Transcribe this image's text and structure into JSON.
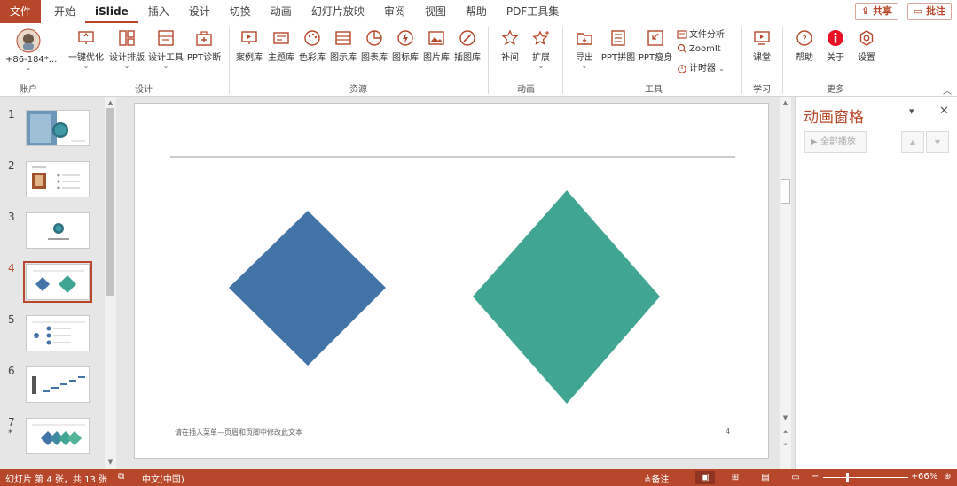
{
  "tabs": [
    "文件",
    "开始",
    "iSlide",
    "插入",
    "设计",
    "切换",
    "动画",
    "幻灯片放映",
    "审阅",
    "视图",
    "帮助",
    "PDF工具集"
  ],
  "share_label": "共享",
  "comment_label": "批注",
  "ribbon": {
    "account": {
      "user": "+86-184*...",
      "group": "账户"
    },
    "design": {
      "buttons": [
        "一键优化",
        "设计排版",
        "设计工具",
        "PPT诊断"
      ],
      "group": "设计"
    },
    "resources": {
      "buttons": [
        "案例库",
        "主题库",
        "色彩库",
        "图示库",
        "图表库",
        "图标库",
        "图片库",
        "插图库"
      ],
      "group": "资源"
    },
    "animation": {
      "buttons": [
        "补间",
        "扩展"
      ],
      "group": "动画"
    },
    "tools": {
      "buttons": [
        "导出",
        "PPT拼图",
        "PPT瘦身"
      ],
      "small": [
        "文件分析",
        "ZoomIt",
        "计时器"
      ],
      "group": "工具"
    },
    "learning": {
      "buttons": [
        "课堂"
      ],
      "group": "学习"
    },
    "more": {
      "buttons": [
        "帮助",
        "关于",
        "设置"
      ],
      "group": "更多"
    }
  },
  "thumbnails": [
    "1",
    "2",
    "3",
    "4",
    "5",
    "6",
    "7"
  ],
  "selected_slide": "4",
  "slide7_mark": "*",
  "slide": {
    "footer_text": "请在插入菜单—页眉和页脚中修改此文本",
    "page_number": "4",
    "colors": {
      "left_diamond": "#4374a7",
      "right_diamond": "#40a592"
    }
  },
  "anim_pane": {
    "title": "动画窗格",
    "play_all": "全部播放"
  },
  "status": {
    "slide_info": "幻灯片 第 4 张，共 13 张",
    "language": "中文(中国)",
    "notes": "备注",
    "zoom": "66%"
  },
  "colors": {
    "accent": "#b7472a"
  }
}
